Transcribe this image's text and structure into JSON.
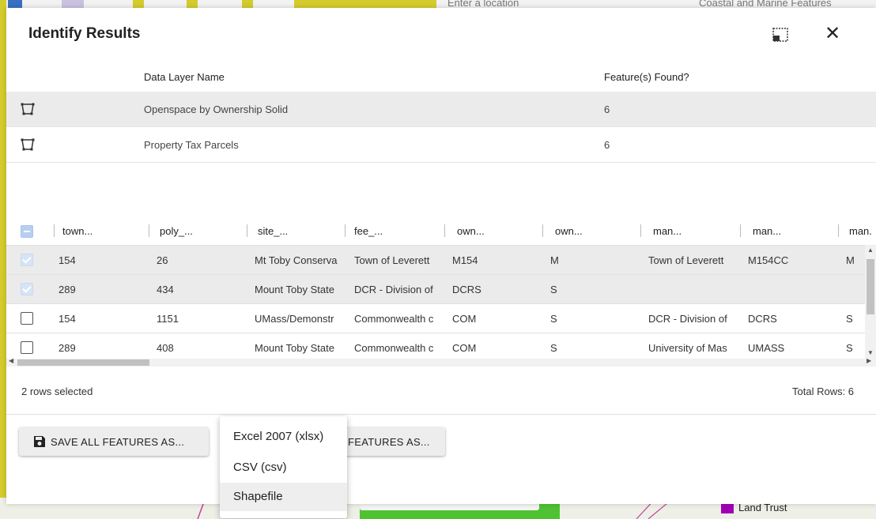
{
  "background": {
    "location_placeholder": "Enter a location",
    "layer_tab": "Coastal and Marine Features",
    "legend_label": "Land Trust",
    "legend_color": "#a000b4",
    "accent_color": "#d4cc2c",
    "green_color": "#4fc232"
  },
  "dialog": {
    "title": "Identify Results",
    "layers": {
      "headers": {
        "name": "Data Layer Name",
        "found": "Feature(s) Found?"
      },
      "rows": [
        {
          "name": "Openspace by Ownership Solid",
          "found": "6"
        },
        {
          "name": "Property Tax Parcels",
          "found": "6"
        }
      ]
    },
    "grid": {
      "columns": [
        "town...",
        "poly_...",
        "site_...",
        "fee_...",
        "own...",
        "own...",
        "man...",
        "man...",
        "man."
      ],
      "rows": [
        {
          "checked": true,
          "cells": [
            "154",
            "26",
            "Mt Toby Conserva",
            "Town of Leverett",
            "M154",
            "M",
            "Town of Leverett",
            "M154CC",
            "M"
          ]
        },
        {
          "checked": true,
          "cells": [
            "289",
            "434",
            "Mount Toby State",
            "DCR - Division of",
            "DCRS",
            "S",
            "",
            "",
            ""
          ]
        },
        {
          "checked": false,
          "cells": [
            "154",
            "1151",
            "UMass/Demonstr",
            "Commonwealth c",
            "COM",
            "S",
            "DCR - Division of",
            "DCRS",
            "S"
          ]
        },
        {
          "checked": false,
          "cells": [
            "289",
            "408",
            "Mount Toby State",
            "Commonwealth c",
            "COM",
            "S",
            "University of Mas",
            "UMASS",
            "S"
          ]
        }
      ]
    },
    "footer": {
      "selected": "2 rows selected",
      "total": "Total Rows: 6"
    },
    "buttons": {
      "save_all": "SAVE ALL FEATURES AS...",
      "save_selected_partial": "FEATURES AS..."
    },
    "menu": {
      "items": [
        "Excel 2007 (xlsx)",
        "CSV (csv)",
        "Shapefile"
      ],
      "hovered": "Shapefile"
    }
  }
}
